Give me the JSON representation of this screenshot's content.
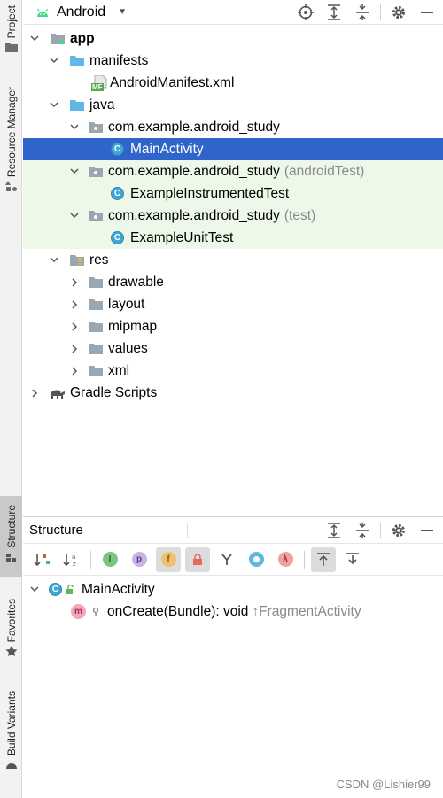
{
  "side_strip": {
    "project": "Project",
    "resource_manager": "Resource Manager",
    "structure": "Structure",
    "favorites": "Favorites",
    "build_variants": "Build Variants"
  },
  "project_panel": {
    "view_mode": "Android",
    "tree": {
      "app": "app",
      "manifests": "manifests",
      "manifest_file": "AndroidManifest.xml",
      "mf_badge": "MF",
      "java": "java",
      "pkg_main": "com.example.android_study",
      "main_activity": "MainActivity",
      "pkg_android_test": "com.example.android_study",
      "android_test_suffix": "(androidTest)",
      "instrumented_test": "ExampleInstrumentedTest",
      "pkg_test": "com.example.android_study",
      "test_suffix": "(test)",
      "unit_test": "ExampleUnitTest",
      "res": "res",
      "drawable": "drawable",
      "layout": "layout",
      "mipmap": "mipmap",
      "values": "values",
      "xml": "xml",
      "gradle_scripts": "Gradle Scripts"
    }
  },
  "structure_panel": {
    "title": "Structure",
    "tool_letters": {
      "i": "I",
      "p": "p",
      "f": "f",
      "lambda": "λ"
    },
    "class_name": "MainActivity",
    "method_signature": "onCreate(Bundle): void",
    "method_origin": "↑FragmentActivity",
    "method_badge": "m"
  },
  "class_badge": "C",
  "watermark": "CSDN @Lishier99",
  "colors": {
    "selection": "#2f65ca",
    "test_highlight": "#eef8e8",
    "android_green": "#3ddc84",
    "class_icon": "#3fa7d6"
  }
}
